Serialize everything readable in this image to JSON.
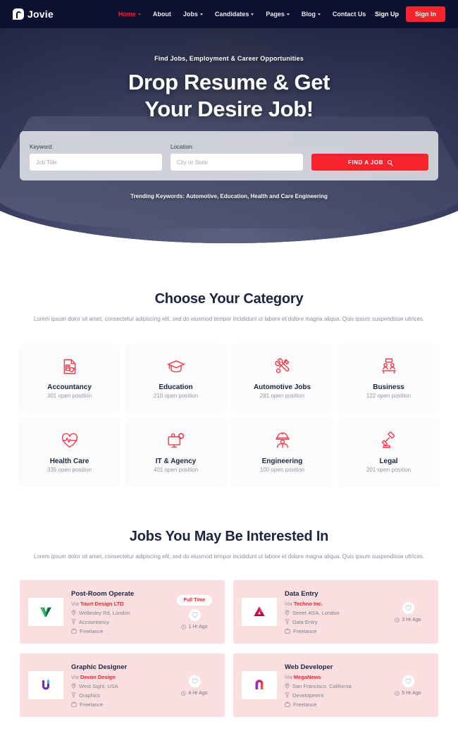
{
  "brand": {
    "name": "Jovie",
    "logo_icon": "jovie-hook-logo-icon",
    "accent_color": "#f8232c",
    "navbar_color": "#0d1130"
  },
  "navbar": {
    "menu": [
      {
        "label": "Home",
        "has_caret": true,
        "active": true
      },
      {
        "label": "About",
        "has_caret": false,
        "active": false
      },
      {
        "label": "Jobs",
        "has_caret": true,
        "active": false
      },
      {
        "label": "Candidates",
        "has_caret": true,
        "active": false
      },
      {
        "label": "Pages",
        "has_caret": true,
        "active": false
      },
      {
        "label": "Blog",
        "has_caret": true,
        "active": false
      },
      {
        "label": "Contact Us",
        "has_caret": false,
        "active": false
      }
    ],
    "signup_label": "Sign Up",
    "signin_label": "Sign In"
  },
  "hero": {
    "eyebrow": "Find Jobs, Employment & Career Opportunities",
    "title_line1": "Drop Resume & Get",
    "title_line2": "Your Desire Job!",
    "trending": "Trending Keywords: Automotive, Education, Health and Care Engineering"
  },
  "search": {
    "keyword_label": "Keyword:",
    "keyword_placeholder": "Job Title",
    "keyword_value": "",
    "location_label": "Location:",
    "location_placeholder": "City or State",
    "location_value": "",
    "submit_label": "FIND A JOB",
    "submit_icon": "search-icon"
  },
  "categories_section": {
    "title": "Choose Your Category",
    "description": "Lorem ipsum dolor sit amet, consectetur adipiscing elit, sed do eiusmod tempor incididunt ut labore et dolore magna aliqua. Quis ipsum suspendisse ultrices.",
    "items": [
      {
        "name": "Accountancy",
        "count": "301 open position",
        "icon": "accounting-document-icon"
      },
      {
        "name": "Education",
        "count": "210 open position",
        "icon": "graduation-cap-icon"
      },
      {
        "name": "Automotive Jobs",
        "count": "281 open position",
        "icon": "wrench-screwdriver-icon"
      },
      {
        "name": "Business",
        "count": "122 open position",
        "icon": "business-meeting-icon"
      },
      {
        "name": "Health Care",
        "count": "335 open position",
        "icon": "heart-pulse-icon"
      },
      {
        "name": "IT & Agency",
        "count": "401 open position",
        "icon": "monitor-gear-icon"
      },
      {
        "name": "Engineering",
        "count": "100 open position",
        "icon": "engineer-helmet-icon"
      },
      {
        "name": "Legal",
        "count": "201 open position",
        "icon": "gavel-icon"
      }
    ]
  },
  "jobs_section": {
    "title": "Jobs You May Be Interested In",
    "description": "Lorem ipsum dolor sit amet, consectetur adipiscing elit, sed do eiusmod tempor incididunt ut labore et dolore magna aliqua. Quis ipsum suspendisse ultrices.",
    "via_prefix": "Via",
    "items": [
      {
        "title": "Post-Room Operate",
        "company": "Tourt Design LTD",
        "location": "Wellesley Rd, London",
        "category": "Accountancy",
        "type": "Freelance",
        "badge": "Full Time",
        "time": "1 Hr Ago",
        "logo_icon": "tourt-design-v-logo-icon"
      },
      {
        "title": "Data Entry",
        "company": "Techno Inc.",
        "location": "Street 40/A, London",
        "category": "Data Entry",
        "type": "Freelance",
        "badge": "",
        "time": "3 Hr Ago",
        "logo_icon": "techno-triangle-logo-icon"
      },
      {
        "title": "Graphic Designer",
        "company": "Devon Design",
        "location": "West Sight, USA",
        "category": "Graphics",
        "type": "Freelance",
        "badge": "",
        "time": "4 Hr Ago",
        "logo_icon": "devon-design-u-logo-icon"
      },
      {
        "title": "Web Developer",
        "company": "MegaNews",
        "location": "San Francisco, California",
        "category": "Development",
        "type": "Freelance",
        "badge": "",
        "time": "5 Hr Ago",
        "logo_icon": "meganews-hook-logo-icon"
      }
    ]
  }
}
